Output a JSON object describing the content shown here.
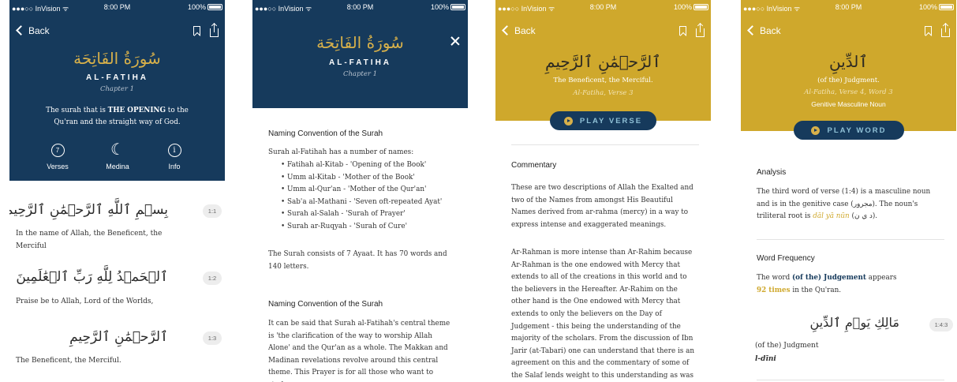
{
  "status": {
    "carrier": "●●●○○ InVision ᯤ",
    "time": "8:00 PM",
    "battery": "100%"
  },
  "screen1": {
    "back_label": "Back",
    "surah_arabic": "سُورَةُ الفَاتِحَة",
    "surah_name": "AL-FATIHA",
    "chapter": "Chapter 1",
    "desc_pre": "The surah that is ",
    "desc_bold": "THE OPENING",
    "desc_post": " to the Qu'ran and the straight way of God.",
    "stats": [
      {
        "icon_text": "7",
        "label": "Verses"
      },
      {
        "icon_text": "☾",
        "label": "Medina"
      },
      {
        "icon_text": "i",
        "label": "Info"
      }
    ],
    "verses": [
      {
        "arabic": "بِسۡمِ ٱللَّهِ ٱلرَّحۡمَٰنِ ٱلرَّحِيمِ",
        "number": "1:1",
        "translation": "In the name of Allah, the Beneficent, the Merciful"
      },
      {
        "arabic": "ٱلۡحَمۡدُ لِلَّهِ رَبِّ ٱلۡعَٰلَمِينَ",
        "number": "1:2",
        "translation": "Praise be to Allah, Lord of the Worlds,"
      },
      {
        "arabic": "ٱلرَّحۡمَٰنِ ٱلرَّحِيمِ",
        "number": "1:3",
        "translation": "The Beneficent, the Merciful."
      }
    ]
  },
  "screen2": {
    "surah_arabic": "سُورَةُ الفَاتِحَة",
    "surah_name": "AL-FATIHA",
    "chapter": "Chapter 1",
    "section1_title": "Naming Convention of the Surah",
    "section1_intro": "Surah al-Fatihah has a number of names:",
    "names": [
      "Fatihah al-Kitab - 'Opening of the Book'",
      "Umm al-Kitab - 'Mother of the Book'",
      "Umm al-Qur'an - 'Mother of the Qur'an'",
      "Sab'a al-Mathani - 'Seven oft-repeated Ayat'",
      "Surah al-Salah - 'Surah of Prayer'",
      "Surah ar-Ruqyah - 'Surah of Cure'"
    ],
    "section1_outro": "The Surah consists of 7 Ayaat. It has 70 words and 140 letters.",
    "section2_title": "Naming Convention of the Surah",
    "section2_body": "It can be said that Surah al-Fatihah's central theme is 'the clarification of the way to worship Allah Alone' and the Qur'an as a whole. The Makkan and Madinan revelations revolve around this central theme. This Prayer is for all those who want to study"
  },
  "screen3": {
    "back_label": "Back",
    "verse_arabic": "ٱلرَّحۡمَٰنِ ٱلرَّحِيمِ",
    "verse_translation": "The Beneficent, the Merciful.",
    "verse_ref": "Al-Fatiha, Verse 3",
    "play_label": "PLAY VERSE",
    "commentary_title": "Commentary",
    "para1": "These are two descriptions of Allah the Exalted and two of the Names from amongst His Beautiful Names derived from ar-rahma (mercy) in a way to express intense and exaggerated meanings.",
    "para2": "Ar-Rahman is more intense than Ar-Rahim because Ar-Rahman is the one endowed with Mercy that extends to all of the creations in this world and to the believers in the Hereafter. Ar-Rahim on the other hand is the One endowed with Mercy that extends to only the believers on the Day of Judgement - this being the understanding of the majority of the scholars. From the discussion of Ibn Jarir (at-Tabari) one can understand that there is an agreement on this and the commentary of some of the Salaf lends weight to this understanding as was"
  },
  "screen4": {
    "back_label": "Back",
    "word_arabic": "ٱلدِّينِ",
    "word_translation": "(of the) Judgment.",
    "word_ref": "Al-Fatiha, Verse 4, Word 3",
    "word_grammar": "Genitive Masculine Noun",
    "play_label": "PLAY WORD",
    "analysis_title": "Analysis",
    "analysis_pre": "The third word of verse (1:4) is a masculine noun and is in the genitive case (مجرور). The noun's triliteral root is ",
    "analysis_root": "dāl yā nūn",
    "analysis_post": " (د ي ن).",
    "freq_title": "Word Frequency",
    "freq_pre": "The word ",
    "freq_bold": "(of the) Judgement",
    "freq_post": " appears",
    "freq_count": "92 times",
    "freq_end": " in the Qu'ran.",
    "example_arabic": "مَالِكِ يَوۡمِ ٱلدِّينِ",
    "example_number": "1:4:3",
    "example_translation": "(of the) Judgment",
    "example_translit": "l-dīni"
  },
  "colors": {
    "navy": "#163a5c",
    "gold": "#cfa82c"
  }
}
